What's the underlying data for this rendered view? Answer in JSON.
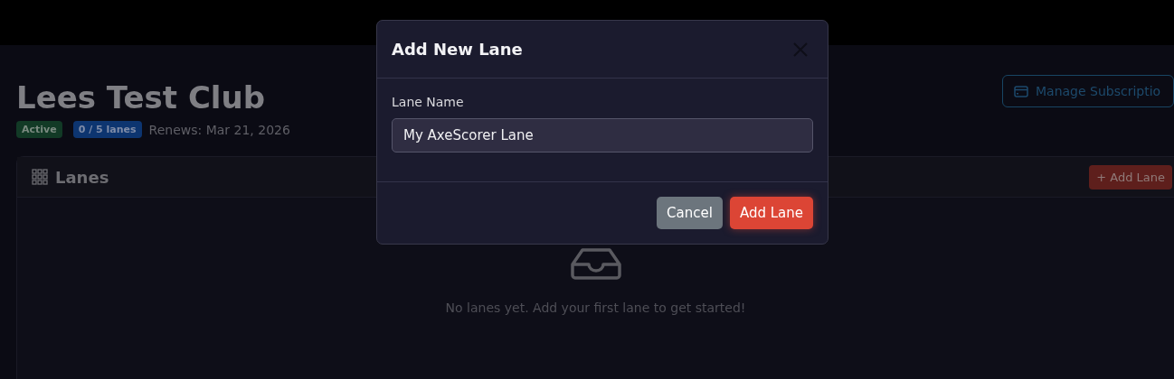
{
  "page": {
    "title": "Lees Test Club",
    "status_badge": "Active",
    "lanes_badge": "0 / 5 lanes",
    "renews": "Renews: Mar 21, 2026",
    "manage_button": "Manage Subscriptio"
  },
  "lanes_card": {
    "title": "Lanes",
    "add_button": "+ Add Lane",
    "empty_message": "No lanes yet. Add your first lane to get started!"
  },
  "modal": {
    "title": "Add New Lane",
    "field_label": "Lane Name",
    "field_value": "My AxeScorer Lane",
    "buttons": [
      {
        "label": "Cancel",
        "kind": "secondary"
      },
      {
        "label": "Add Lane",
        "kind": "primary"
      }
    ]
  }
}
